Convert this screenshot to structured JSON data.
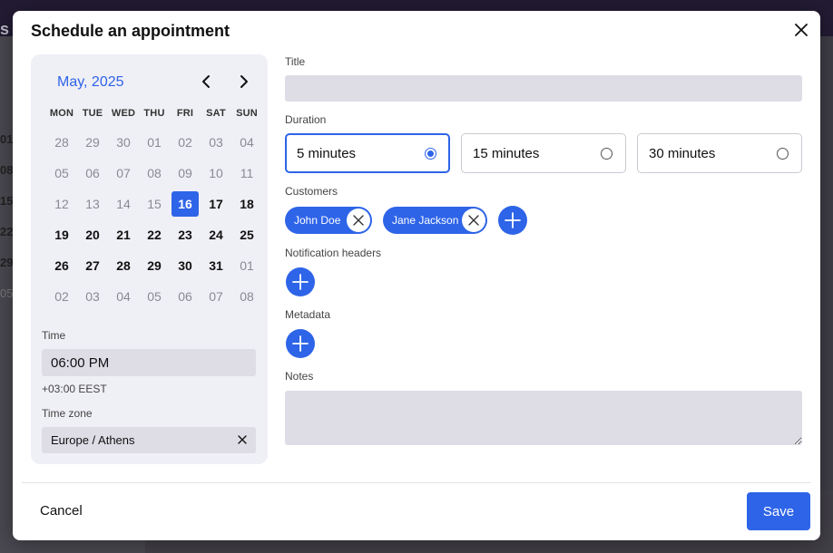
{
  "colors": {
    "accent": "#2e64e8",
    "panel": "#efeff6",
    "input_bg": "#dedde6"
  },
  "modal": {
    "title": "Schedule an appointment",
    "close_icon": "close-icon"
  },
  "calendar": {
    "month_label": "May, 2025",
    "prev_icon": "chevron-left-icon",
    "next_icon": "chevron-right-icon",
    "weekdays": [
      "MON",
      "TUE",
      "WED",
      "THU",
      "FRI",
      "SAT",
      "SUN"
    ],
    "weeks": [
      [
        {
          "d": "28",
          "s": "other"
        },
        {
          "d": "29",
          "s": "other"
        },
        {
          "d": "30",
          "s": "other"
        },
        {
          "d": "01",
          "s": "past"
        },
        {
          "d": "02",
          "s": "past"
        },
        {
          "d": "03",
          "s": "past"
        },
        {
          "d": "04",
          "s": "past"
        }
      ],
      [
        {
          "d": "05",
          "s": "past"
        },
        {
          "d": "06",
          "s": "past"
        },
        {
          "d": "07",
          "s": "past"
        },
        {
          "d": "08",
          "s": "past"
        },
        {
          "d": "09",
          "s": "past"
        },
        {
          "d": "10",
          "s": "past"
        },
        {
          "d": "11",
          "s": "past"
        }
      ],
      [
        {
          "d": "12",
          "s": "past"
        },
        {
          "d": "13",
          "s": "past"
        },
        {
          "d": "14",
          "s": "past"
        },
        {
          "d": "15",
          "s": "past"
        },
        {
          "d": "16",
          "s": "selected"
        },
        {
          "d": "17",
          "s": "future"
        },
        {
          "d": "18",
          "s": "future"
        }
      ],
      [
        {
          "d": "19",
          "s": "future"
        },
        {
          "d": "20",
          "s": "future"
        },
        {
          "d": "21",
          "s": "future"
        },
        {
          "d": "22",
          "s": "future"
        },
        {
          "d": "23",
          "s": "future"
        },
        {
          "d": "24",
          "s": "future"
        },
        {
          "d": "25",
          "s": "future"
        }
      ],
      [
        {
          "d": "26",
          "s": "future"
        },
        {
          "d": "27",
          "s": "future"
        },
        {
          "d": "28",
          "s": "future"
        },
        {
          "d": "29",
          "s": "future"
        },
        {
          "d": "30",
          "s": "future"
        },
        {
          "d": "31",
          "s": "future"
        },
        {
          "d": "01",
          "s": "other"
        }
      ],
      [
        {
          "d": "02",
          "s": "other"
        },
        {
          "d": "03",
          "s": "other"
        },
        {
          "d": "04",
          "s": "other"
        },
        {
          "d": "05",
          "s": "other"
        },
        {
          "d": "06",
          "s": "other"
        },
        {
          "d": "07",
          "s": "other"
        },
        {
          "d": "08",
          "s": "other"
        }
      ]
    ]
  },
  "time": {
    "label": "Time",
    "value": "06:00 PM",
    "offset": "+03:00 EEST"
  },
  "timezone": {
    "label": "Time zone",
    "value": "Europe / Athens"
  },
  "form": {
    "title_label": "Title",
    "title_value": "",
    "duration_label": "Duration",
    "durations": [
      {
        "label": "5 minutes",
        "selected": true
      },
      {
        "label": "15 minutes",
        "selected": false
      },
      {
        "label": "30 minutes",
        "selected": false
      }
    ],
    "customers_label": "Customers",
    "customers": [
      "John Doe",
      "Jane Jackson"
    ],
    "notification_headers_label": "Notification headers",
    "metadata_label": "Metadata",
    "notes_label": "Notes",
    "notes_value": ""
  },
  "footer": {
    "cancel_label": "Cancel",
    "save_label": "Save"
  },
  "background": {
    "fragments": [
      "s",
      "01",
      "08",
      "15",
      "22",
      "29",
      "05"
    ]
  }
}
